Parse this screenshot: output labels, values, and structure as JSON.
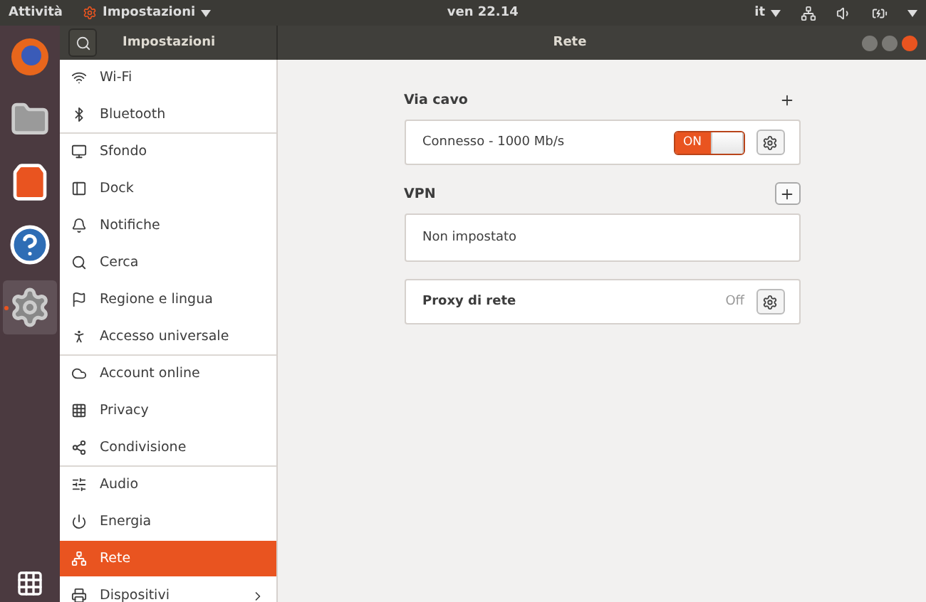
{
  "top_bar": {
    "activities": "Attività",
    "app_menu": "Impostazioni",
    "clock": "ven 22.14",
    "input_source": "it"
  },
  "dock": {
    "apps": [
      {
        "kind": "browser",
        "running": false
      },
      {
        "kind": "files",
        "running": false
      },
      {
        "kind": "software",
        "running": false
      },
      {
        "kind": "help",
        "running": false
      },
      {
        "kind": "settings",
        "running": true
      }
    ]
  },
  "sidebar": {
    "title": "Impostazioni",
    "items": [
      {
        "label": "Wi-Fi",
        "selected": false,
        "group_end": false,
        "has_children": false
      },
      {
        "label": "Bluetooth",
        "selected": false,
        "group_end": true,
        "has_children": false
      },
      {
        "label": "Sfondo",
        "selected": false,
        "group_end": false,
        "has_children": false
      },
      {
        "label": "Dock",
        "selected": false,
        "group_end": false,
        "has_children": false
      },
      {
        "label": "Notifiche",
        "selected": false,
        "group_end": false,
        "has_children": false
      },
      {
        "label": "Cerca",
        "selected": false,
        "group_end": false,
        "has_children": false
      },
      {
        "label": "Regione e lingua",
        "selected": false,
        "group_end": false,
        "has_children": false
      },
      {
        "label": "Accesso universale",
        "selected": false,
        "group_end": true,
        "has_children": false
      },
      {
        "label": "Account online",
        "selected": false,
        "group_end": false,
        "has_children": false
      },
      {
        "label": "Privacy",
        "selected": false,
        "group_end": false,
        "has_children": false
      },
      {
        "label": "Condivisione",
        "selected": false,
        "group_end": true,
        "has_children": false
      },
      {
        "label": "Audio",
        "selected": false,
        "group_end": false,
        "has_children": false
      },
      {
        "label": "Energia",
        "selected": false,
        "group_end": false,
        "has_children": false
      },
      {
        "label": "Rete",
        "selected": true,
        "group_end": false,
        "has_children": false
      },
      {
        "label": "Dispositivi",
        "selected": false,
        "group_end": false,
        "has_children": true
      }
    ]
  },
  "content": {
    "title": "Rete",
    "sections": [
      {
        "kind": "wired",
        "heading": "Via cavo",
        "add_button_focused": false,
        "rows": [
          {
            "label": "Connesso - 1000 Mb/s",
            "switch_label": "ON",
            "on": true
          }
        ]
      },
      {
        "kind": "vpn",
        "heading": "VPN",
        "add_button_focused": true,
        "rows": [
          {
            "label": "Non impostato"
          }
        ]
      },
      {
        "kind": "proxy",
        "rows": [
          {
            "label": "Proxy di rete",
            "status": "Off"
          }
        ]
      }
    ]
  }
}
